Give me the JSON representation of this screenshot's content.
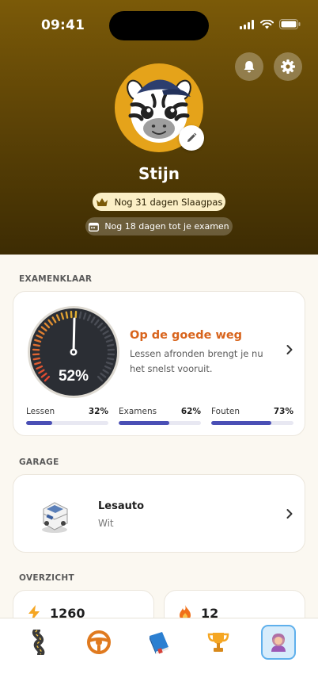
{
  "status_bar": {
    "time": "09:41"
  },
  "profile": {
    "name": "Stijn",
    "slaagpas_text": "Nog 31 dagen Slaagpas",
    "exam_text": "Nog 18 dagen tot je examen"
  },
  "examenklaar": {
    "section_label": "EXAMENKLAAR",
    "gauge_percent": "52%",
    "gauge_value": 0.52,
    "title": "Op de goede weg",
    "description": "Lessen afronden brengt je nu het snelst vooruit.",
    "stats": [
      {
        "label": "Lessen",
        "percent": "32%",
        "value": 0.32
      },
      {
        "label": "Examens",
        "percent": "62%",
        "value": 0.62
      },
      {
        "label": "Fouten",
        "percent": "73%",
        "value": 0.73
      }
    ]
  },
  "garage": {
    "section_label": "GARAGE",
    "car_name": "Lesauto",
    "car_color": "Wit"
  },
  "overzicht": {
    "section_label": "OVERZICHT",
    "items": [
      {
        "icon": "lightning-icon",
        "value": "1260"
      },
      {
        "icon": "flame-icon",
        "value": "12"
      }
    ]
  },
  "tabbar": {
    "tabs": [
      {
        "icon": "road-icon",
        "active": false
      },
      {
        "icon": "steering-wheel-icon",
        "active": false
      },
      {
        "icon": "book-icon",
        "active": false
      },
      {
        "icon": "trophy-icon",
        "active": false
      },
      {
        "icon": "profile-avatar-icon",
        "active": true
      }
    ]
  },
  "colors": {
    "accent_orange": "#d8641c",
    "progress_blue": "#4a4fb5",
    "hero_brown": "#6a4c07",
    "active_tab_blue": "#5fb0ec"
  }
}
